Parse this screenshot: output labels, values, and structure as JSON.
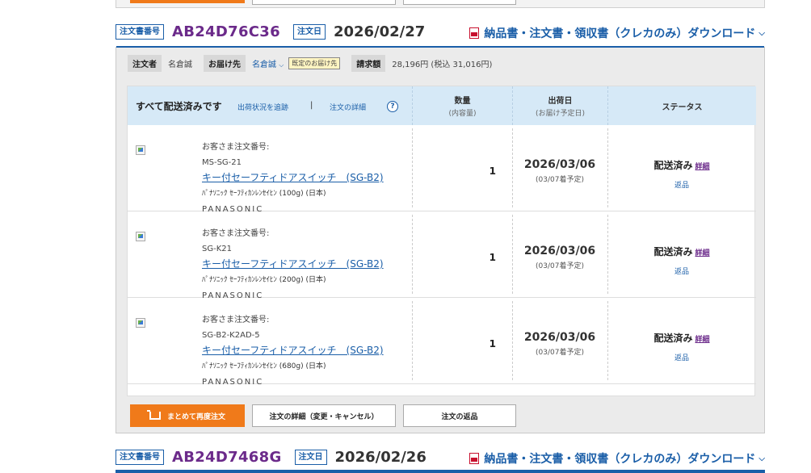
{
  "colors": {
    "accent": "#1a5ea8",
    "order_number": "#6b2a8a",
    "button_orange": "#f07a1a",
    "header_bg": "#d6e9f7"
  },
  "order1": {
    "tag_label": "注文書番号",
    "number": "AB24D76C36",
    "date_label": "注文日",
    "date": "2026/02/27",
    "download_label": "納品書・注文書・領収書（クレカのみ）ダウンロード",
    "download_icon": "pdf-icon",
    "orderer_label": "注文者",
    "orderer_name": "名倉誠",
    "ship_to_label": "お届け先",
    "ship_to_name": "名倉誠",
    "ship_to_badge": "既定のお届け先",
    "billing_label": "請求額",
    "billing_amount": "28,196円 (税込 31,016円)",
    "header": {
      "all_shipped": "すべて配送済みです",
      "track_link": "出荷状況を追跡",
      "separator": "|",
      "details_link": "注文の詳細",
      "help_icon": "?",
      "qty_label": "数量",
      "qty_sub": "(内容量)",
      "ship_label": "出荷日",
      "ship_sub": "(お届け予定日)",
      "status_label": "ステータス"
    },
    "items": [
      {
        "cust_no_label": "お客さま注文番号:",
        "cust_no": "MS-SG-21",
        "product": "キー付セーフティドアスイッチ　(SG-B2)",
        "spec": "ﾊﾟﾅｿﾆｯｸ ｾｰﾌﾃｨｶﾝﾚﾝｾｲﾋﾝ (100g) (日本)",
        "maker": "PANASONIC",
        "qty": "1",
        "ship_date": "2026/03/06",
        "arrival": "(03/07着予定)",
        "status": "配送済み",
        "details": "詳細",
        "return": "返品"
      },
      {
        "cust_no_label": "お客さま注文番号:",
        "cust_no": "SG-K21",
        "product": "キー付セーフティドアスイッチ　(SG-B2)",
        "spec": "ﾊﾟﾅｿﾆｯｸ ｾｰﾌﾃｨｶﾝﾚﾝｾｲﾋﾝ (200g) (日本)",
        "maker": "PANASONIC",
        "qty": "1",
        "ship_date": "2026/03/06",
        "arrival": "(03/07着予定)",
        "status": "配送済み",
        "details": "詳細",
        "return": "返品"
      },
      {
        "cust_no_label": "お客さま注文番号:",
        "cust_no": "SG-B2-K2AD-5",
        "product": "キー付セーフティドアスイッチ　(SG-B2)",
        "spec": "ﾊﾟﾅｿﾆｯｸ ｾｰﾌﾃｨｶﾝﾚﾝｾｲﾋﾝ (680g) (日本)",
        "maker": "PANASONIC",
        "qty": "1",
        "ship_date": "2026/03/06",
        "arrival": "(03/07着予定)",
        "status": "配送済み",
        "details": "詳細",
        "return": "返品"
      }
    ],
    "buttons": {
      "reorder": "まとめて再度注文",
      "order_details": "注文の詳細（変更・キャンセル）",
      "return": "注文の返品"
    }
  },
  "order2": {
    "tag_label": "注文書番号",
    "number": "AB24D7468G",
    "date_label": "注文日",
    "date": "2026/02/26",
    "download_label": "納品書・注文書・領収書（クレカのみ）ダウンロード",
    "download_icon": "pdf-icon"
  }
}
